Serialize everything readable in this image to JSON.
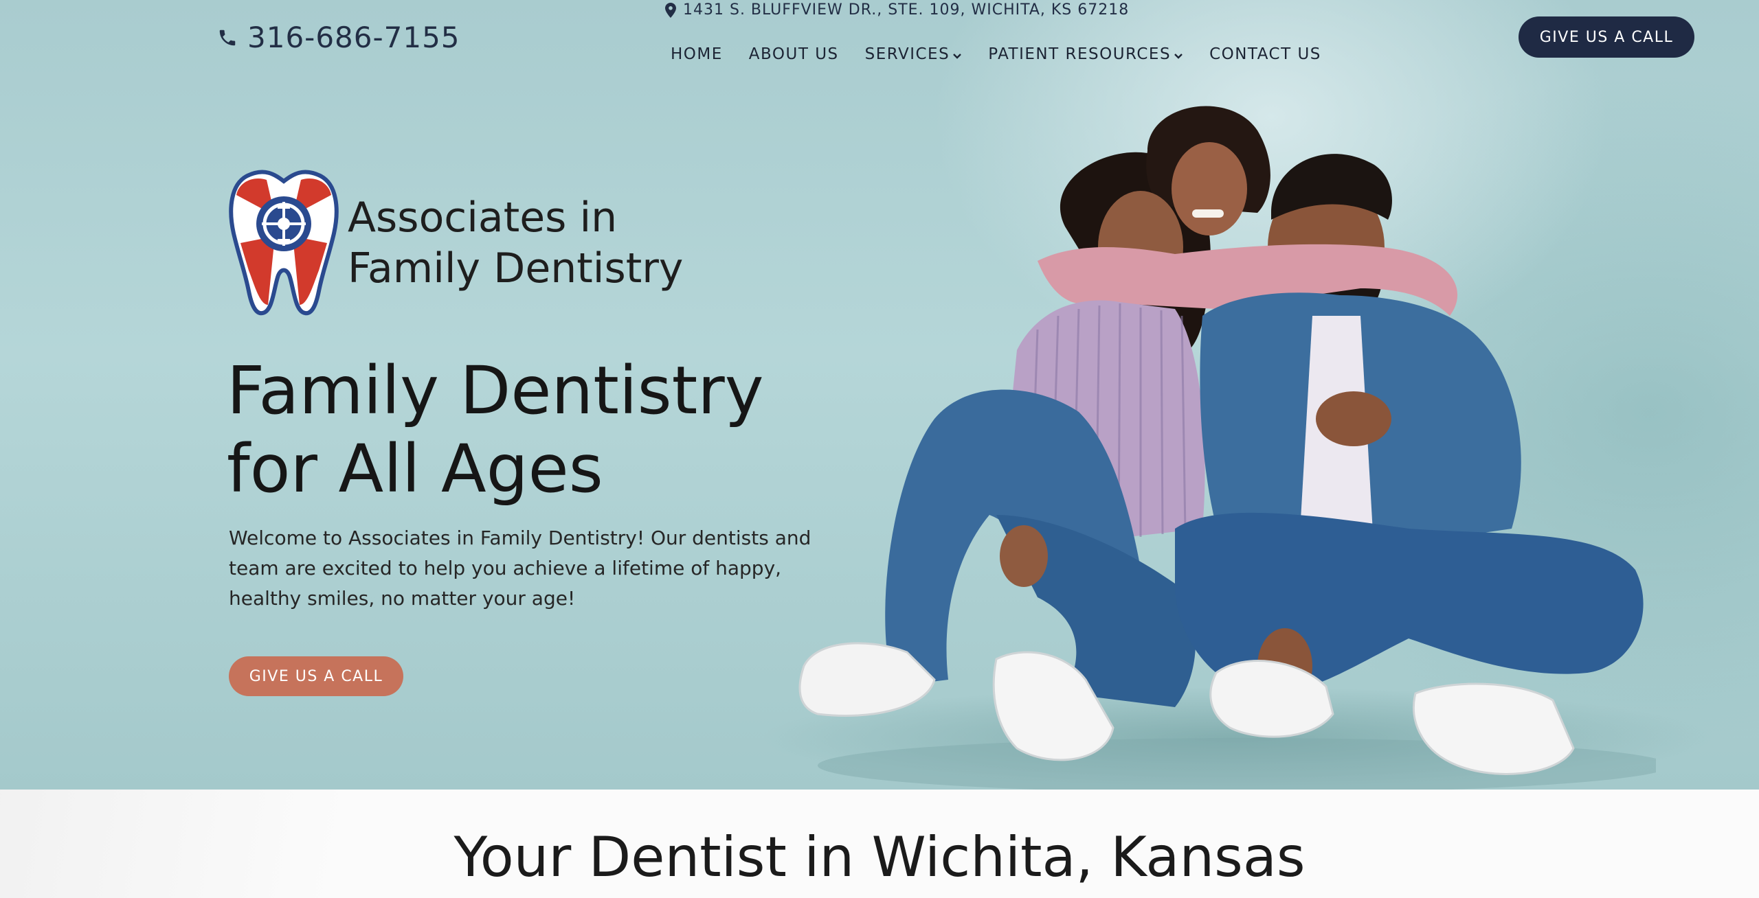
{
  "header": {
    "phone": "316-686-7155",
    "address": "1431 S. BLUFFVIEW DR., STE. 109, WICHITA, KS 67218",
    "cta_label": "GIVE US A CALL"
  },
  "nav": {
    "items": [
      {
        "label": "HOME",
        "dropdown": false
      },
      {
        "label": "ABOUT US",
        "dropdown": false
      },
      {
        "label": "SERVICES",
        "dropdown": true
      },
      {
        "label": "PATIENT RESOURCES",
        "dropdown": true
      },
      {
        "label": "CONTACT US",
        "dropdown": false
      }
    ]
  },
  "logo": {
    "line1": "Associates in",
    "line2": "Family Dentistry"
  },
  "hero": {
    "headline_line1": "Family Dentistry",
    "headline_line2": "for All Ages",
    "welcome": "Welcome to Associates in Family Dentistry! Our dentists and team are excited to help you achieve a lifetime of happy, healthy smiles, no matter your age!",
    "cta_label": "GIVE US A CALL"
  },
  "section": {
    "title": "Your Dentist in Wichita, Kansas"
  },
  "colors": {
    "navy": "#1f2a44",
    "accent": "#c6735b",
    "hero_bg": "#a9cccf",
    "logo_red": "#d23a2c",
    "logo_blue": "#2a4a8f"
  },
  "icons": [
    "phone-icon",
    "map-pin-icon",
    "chevron-down-icon",
    "tooth-logo-icon"
  ]
}
